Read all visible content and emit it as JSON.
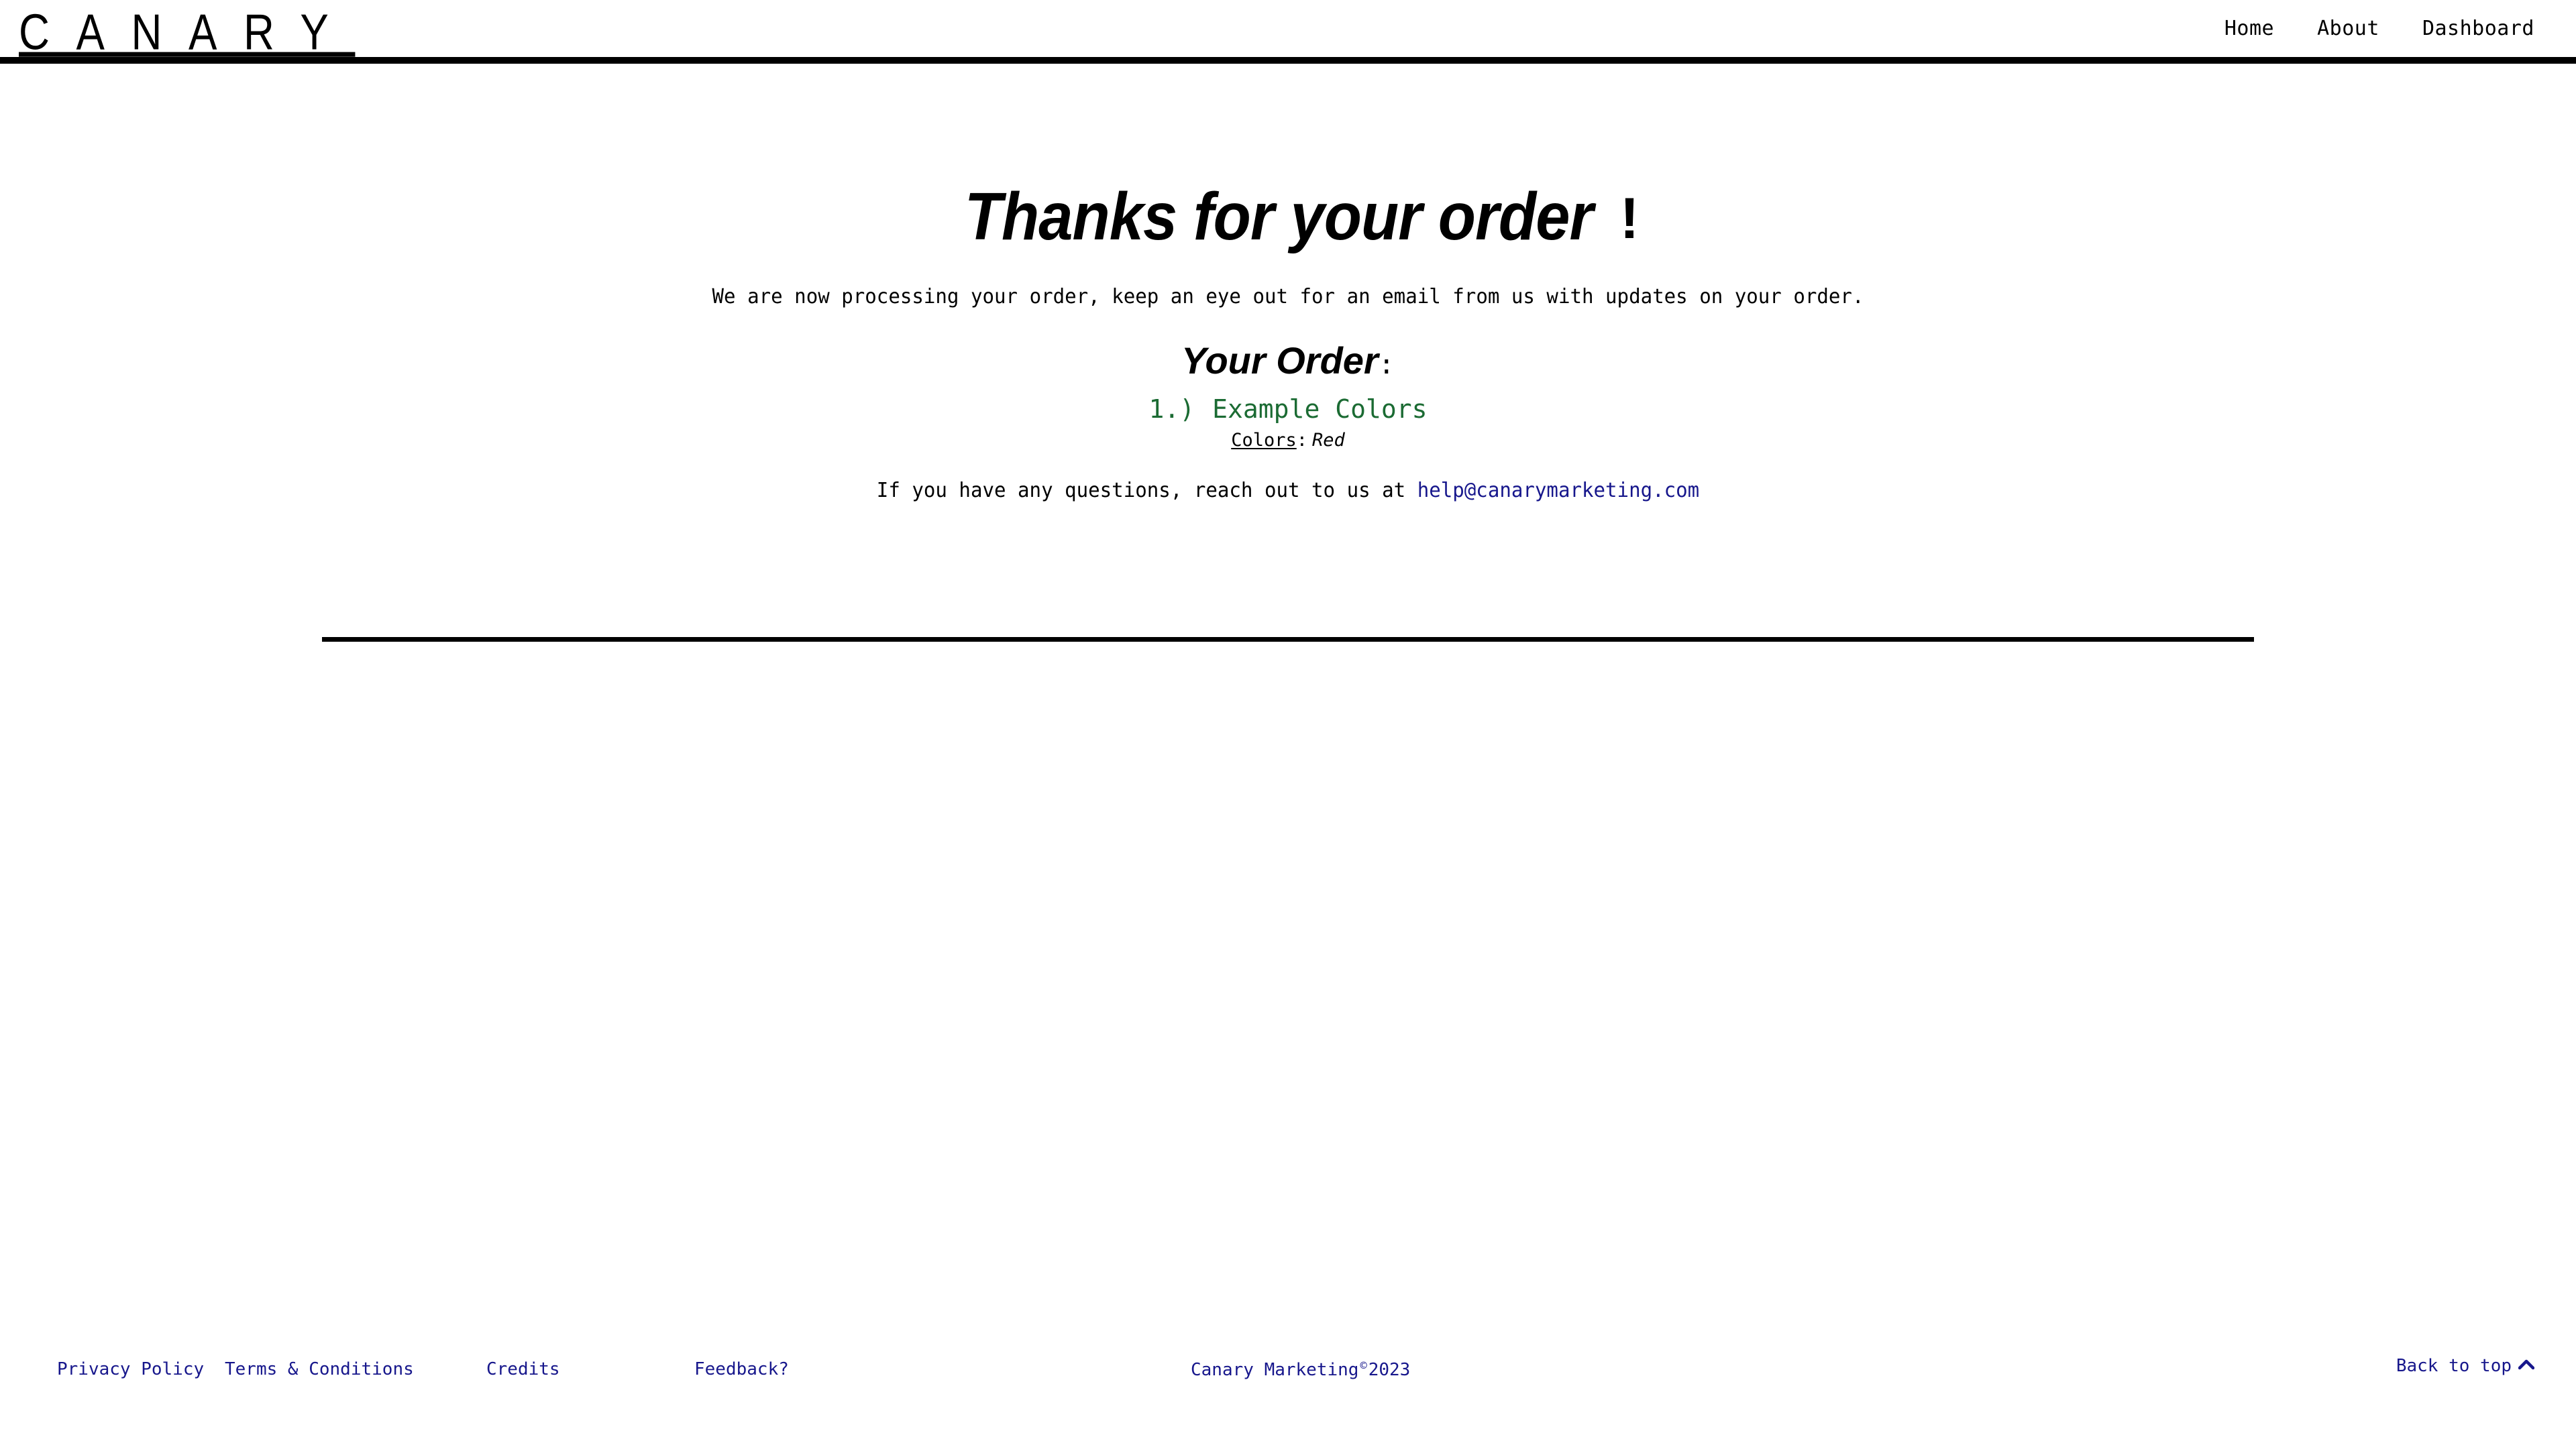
{
  "header": {
    "brand": "CANARY",
    "nav": [
      {
        "label": "Home",
        "name": "nav-link-home"
      },
      {
        "label": "About",
        "name": "nav-link-about"
      },
      {
        "label": "Dashboard",
        "name": "nav-link-dashboard"
      }
    ]
  },
  "main": {
    "headline": "Thanks for your order",
    "headline_punctuation": "!",
    "processing_note": "We are now processing your order, keep an eye out for an email from us with updates on your order.",
    "order_heading": "Your Order",
    "order_heading_colon": ":",
    "order_items": [
      {
        "index": "1.)",
        "title": "Example Colors",
        "attribute_key": "Colors",
        "attribute_separator": ":",
        "attribute_value": "Red"
      }
    ],
    "support_note_prefix": "If you have any questions, reach out to us at ",
    "support_email": "help@canarymarketing.com"
  },
  "footer": {
    "links": [
      {
        "label": "Privacy Policy",
        "name": "footer-link-privacy-policy"
      },
      {
        "label": "Terms & Conditions",
        "name": "footer-link-terms-and-conditions"
      },
      {
        "label": "Credits",
        "name": "footer-link-credits"
      },
      {
        "label": "Feedback?",
        "name": "footer-link-feedback"
      }
    ],
    "copyright_text": "Canary Marketing",
    "copyright_mark": "©",
    "copyright_year": "2023",
    "back_to_top_label": "Back to top"
  },
  "colors": {
    "text": "#000000",
    "link_blue": "#17178C",
    "order_green": "#1B6B33",
    "rule": "#000000",
    "background": "#FFFFFF"
  }
}
